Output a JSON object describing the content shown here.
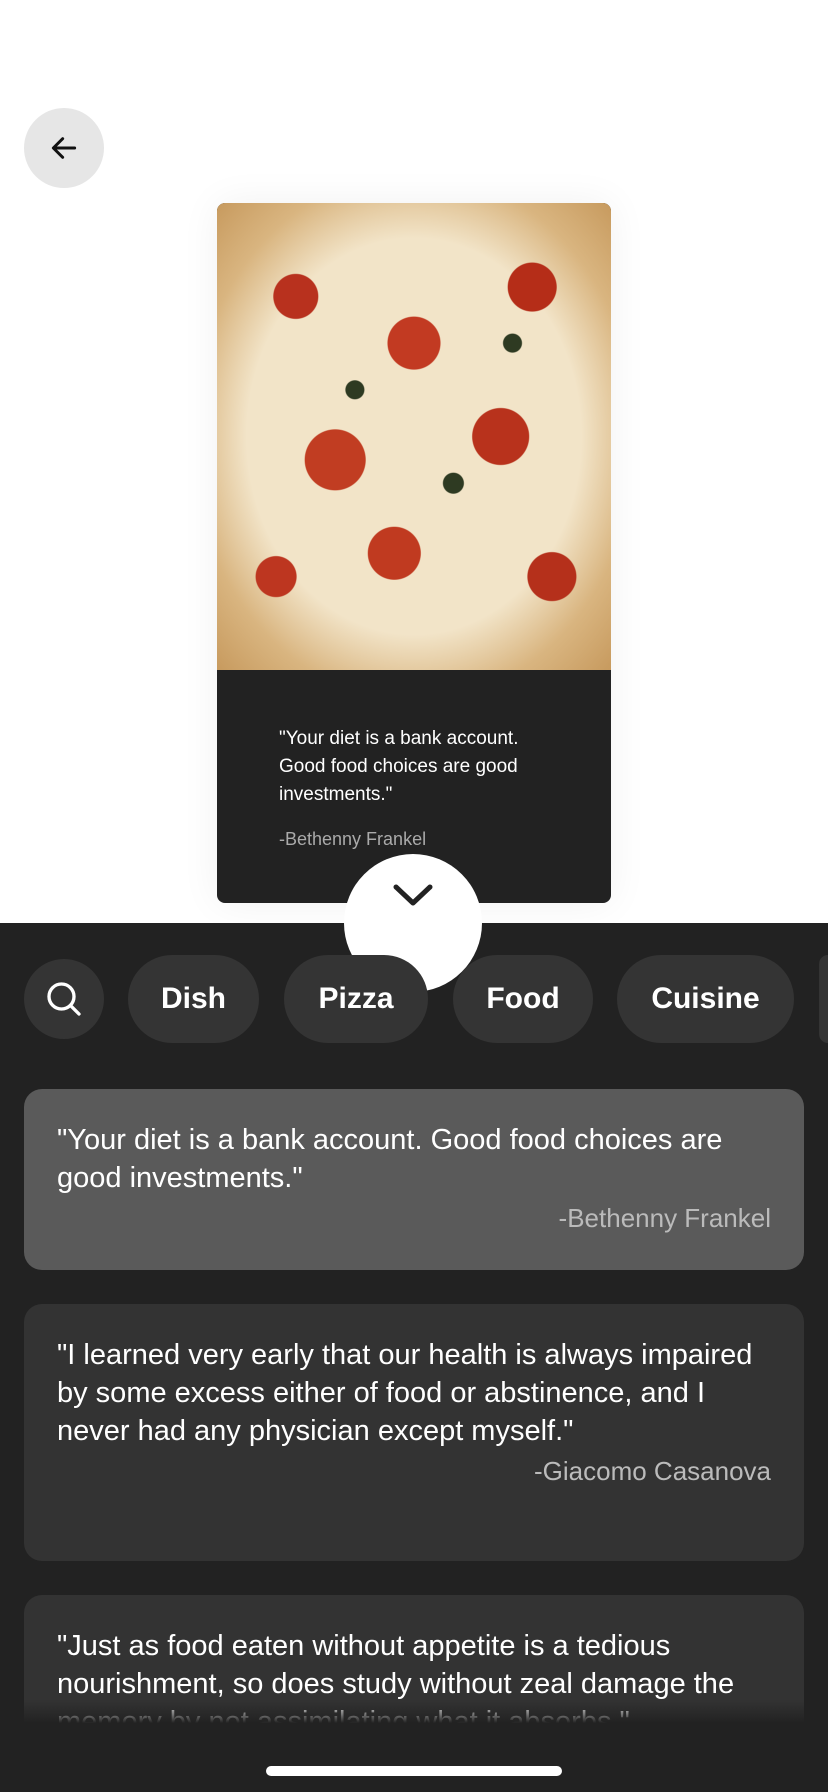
{
  "nav": {
    "back_icon": "arrow-left-icon"
  },
  "preview": {
    "quote": "\"Your diet is a bank account. Good food choices are good investments.\"",
    "author": "-Bethenny Frankel",
    "collapse_icon": "chevron-down-icon"
  },
  "chips": {
    "search_icon": "search-icon",
    "items": [
      "Dish",
      "Pizza",
      "Food",
      "Cuisine"
    ]
  },
  "quotes": [
    {
      "text": "\"Your diet is a bank account. Good food choices are good investments.\"",
      "author": "-Bethenny Frankel",
      "selected": true
    },
    {
      "text": "\"I learned very early that our health is always impaired by some excess either of food or abstinence, and I never had any physician except myself.\"",
      "author": "-Giacomo Casanova"
    },
    {
      "text": "\"Just as food eaten without appetite is a tedious nourishment, so does study without zeal damage the memory by not assimilating what it absorbs.\""
    }
  ],
  "colors": {
    "panel": "#222222",
    "card": "#333333",
    "selected_card": "#5a5a5a"
  }
}
